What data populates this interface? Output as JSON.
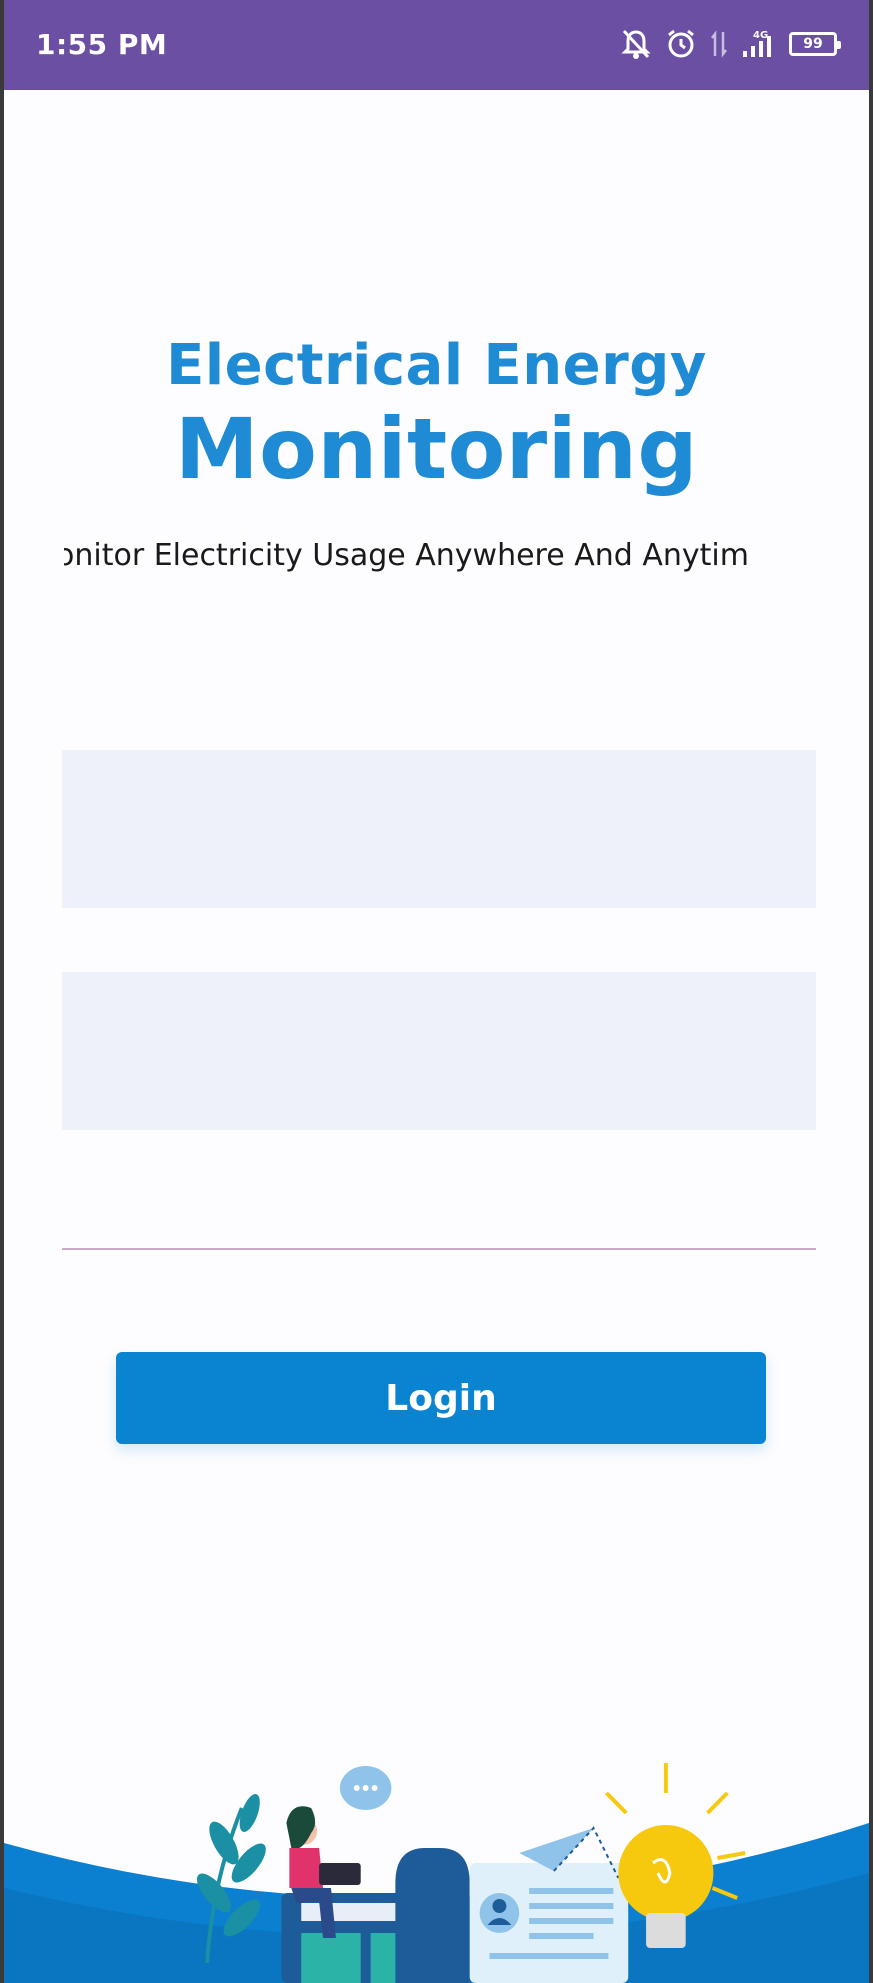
{
  "status_bar": {
    "time": "1:55 PM",
    "battery": "99",
    "network": "4G",
    "icons": [
      "mute-bell-icon",
      "alarm-icon",
      "data-arrows-icon",
      "signal-icon",
      "battery-icon"
    ]
  },
  "header": {
    "title_line1": "Electrical Energy",
    "title_line2": "Monitoring",
    "tagline": "onitor Electricity Usage Anywhere And Anytim"
  },
  "form": {
    "username_value": "",
    "password_value": "",
    "login_label": "Login"
  },
  "colors": {
    "status_bar": "#6a4fa3",
    "brand_blue": "#1e8bd4",
    "button": "#0a84d0",
    "field_bg": "#eef0fa"
  },
  "illustration": {
    "icon": "person-with-laptop-and-lightbulb-illustration"
  }
}
